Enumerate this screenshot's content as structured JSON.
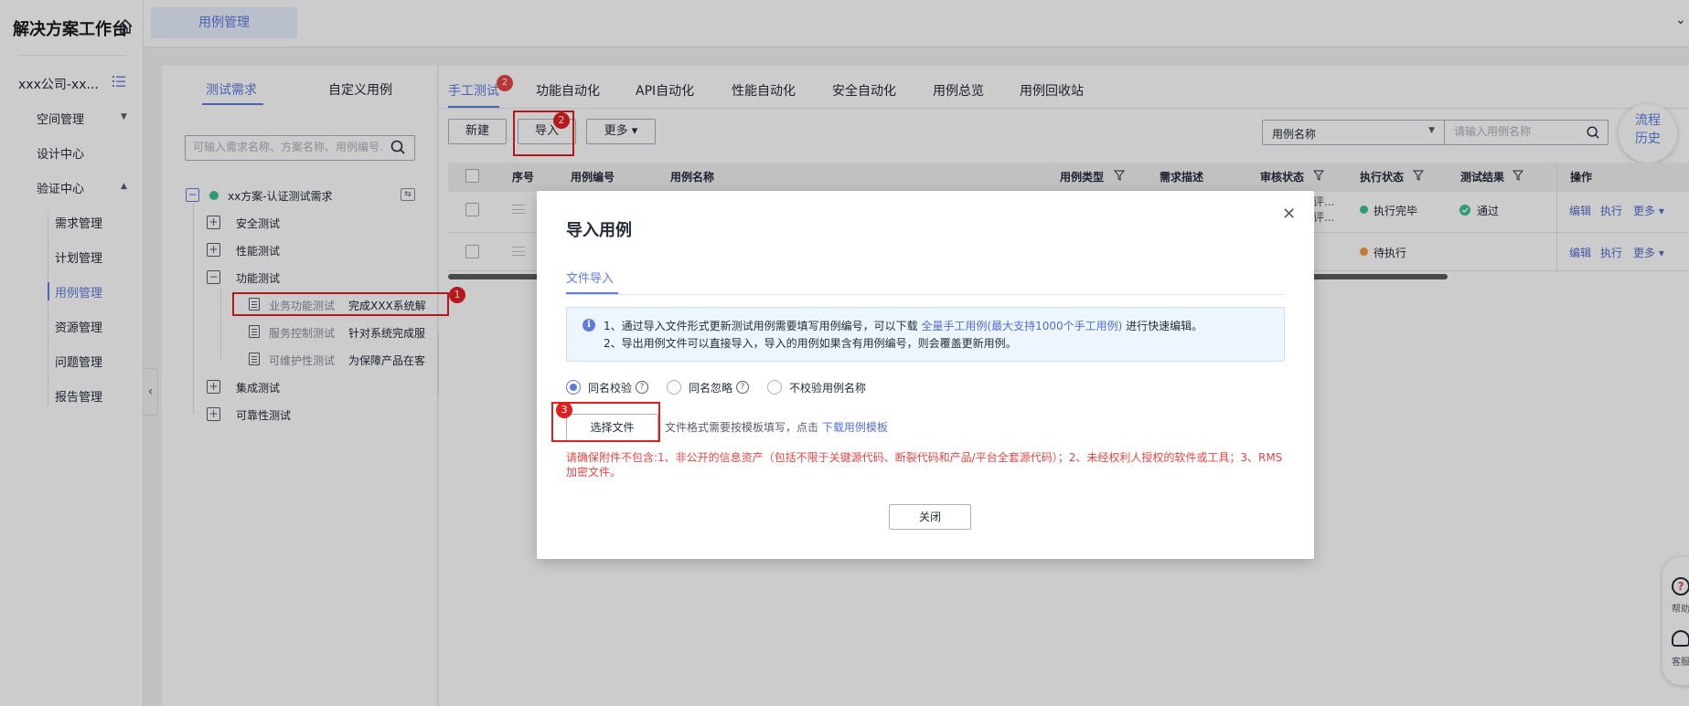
{
  "app": {
    "title": "解决方案工作台"
  },
  "sidebar": {
    "project": "xxx公司-xx...",
    "items": [
      {
        "label": "空间管理",
        "caret": "▼"
      },
      {
        "label": "设计中心",
        "caret": ""
      },
      {
        "label": "验证中心",
        "caret": "▲"
      }
    ],
    "sub_items": [
      "需求管理",
      "计划管理",
      "用例管理",
      "资源管理",
      "问题管理",
      "报告管理"
    ]
  },
  "topbar": {
    "tab": "用例管理",
    "chevron": "⌄"
  },
  "req_panel": {
    "tabs": [
      "测试需求",
      "自定义用例"
    ],
    "search_placeholder": "可输入需求名称、方案名称、用例编号.",
    "tree": {
      "root": "xx方案-认证测试需求",
      "nodes": [
        {
          "label": "安全测试",
          "toggle": "+"
        },
        {
          "label": "性能测试",
          "toggle": "+"
        },
        {
          "label": "功能测试",
          "toggle": "−"
        },
        {
          "label": "集成测试",
          "toggle": "+"
        },
        {
          "label": "可靠性测试",
          "toggle": "+"
        }
      ],
      "leaves": [
        {
          "label": "业务功能测试",
          "desc": "完成XXX系统解"
        },
        {
          "label": "服务控制测试",
          "desc": "针对系统完成服"
        },
        {
          "label": "可维护性测试",
          "desc": "为保障产品在客"
        }
      ]
    }
  },
  "main": {
    "tabs": [
      "手工测试",
      "功能自动化",
      "API自动化",
      "性能自动化",
      "安全自动化",
      "用例总览",
      "用例回收站"
    ],
    "tab_badge": "2",
    "toolbar": {
      "new": "新建",
      "import": "导入",
      "more": "更多 ▾"
    },
    "filter": {
      "select": "用例名称",
      "placeholder": "请输入用例名称"
    },
    "flow_history": [
      "流程",
      "历史"
    ],
    "table": {
      "headers": [
        "序号",
        "用例编号",
        "用例名称",
        "用例类型",
        "需求描述",
        "审核状态",
        "执行状态",
        "测试结果",
        "操作"
      ],
      "rows": [
        {
          "review": [
            "评...",
            "评..."
          ],
          "exec_status": "执行完毕",
          "result": "通过",
          "actions": [
            "编辑",
            "执行",
            "更多 ▾"
          ]
        },
        {
          "review": [
            "",
            ""
          ],
          "exec_status": "待执行",
          "result": "",
          "actions": [
            "编辑",
            "执行",
            "更多 ▾"
          ]
        }
      ]
    }
  },
  "help_float": {
    "help": "帮助",
    "service": "客服"
  },
  "modal": {
    "title": "导入用例",
    "tab": "文件导入",
    "info": {
      "line1_prefix": "1、通过导入文件形式更新测试用例需要填写用例编号，可以下载 ",
      "line1_link": "全量手工用例(最大支持1000个手工用例)",
      "line1_suffix": " 进行快速编辑。",
      "line2": "2、导出用例文件可以直接导入，导入的用例如果含有用例编号，则会覆盖更新用例。"
    },
    "radios": [
      "同名校验",
      "同名忽略",
      "不校验用例名称"
    ],
    "choose_file": "选择文件",
    "file_hint_prefix": "文件格式需要按模板填写，点击 ",
    "file_hint_link": "下载用例模板",
    "warning": "请确保附件不包含:1、非公开的信息资产（包括不限于关键源代码、断裂代码和产品/平台全套源代码）；2、未经权利人授权的软件或工具；3、RMS加密文件。",
    "close": "关闭"
  },
  "annotations": [
    "1",
    "2",
    "3"
  ],
  "colors": {
    "accent": "#5e7ce0",
    "danger": "#e54545",
    "success": "#3ac295",
    "warning": "#fa9841"
  }
}
